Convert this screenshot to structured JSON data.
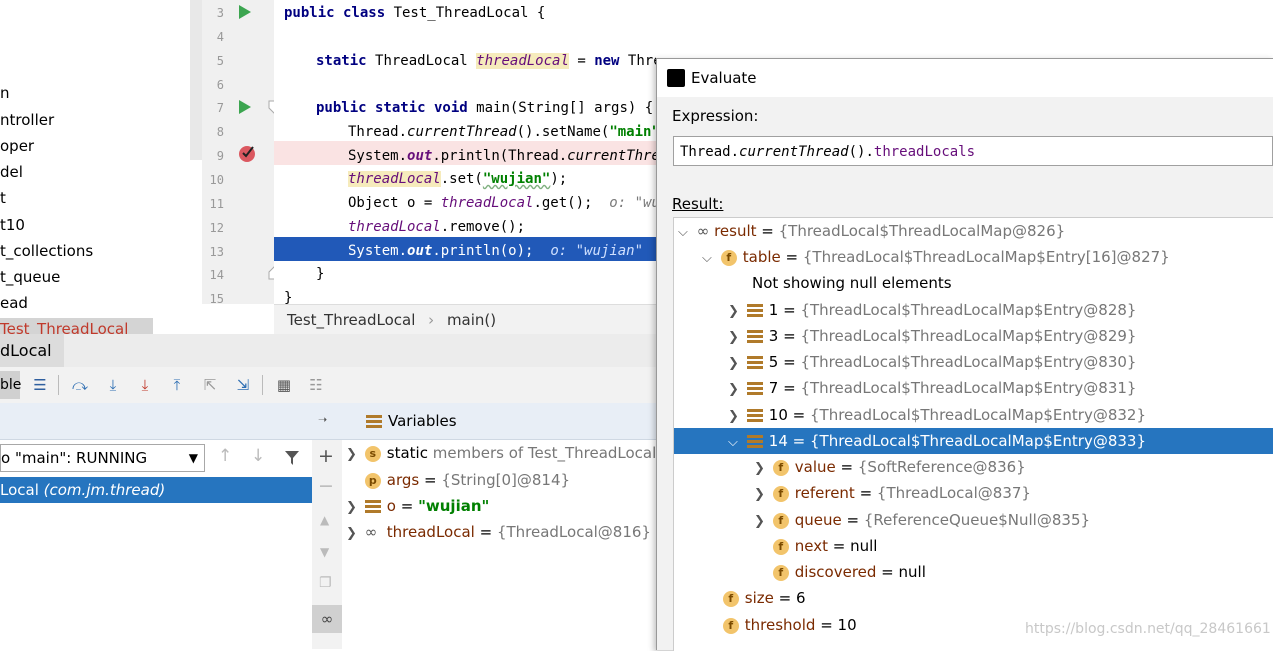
{
  "project_tree": {
    "items": [
      "n",
      "ntroller",
      "oper",
      "del",
      "t",
      "t10",
      "t_collections",
      "t_queue",
      "ead",
      "Test_ThreadLocal"
    ]
  },
  "editor": {
    "line_numbers": [
      "3",
      "4",
      "5",
      "6",
      "7",
      "8",
      "9",
      "10",
      "11",
      "12",
      "13",
      "14",
      "15"
    ],
    "lines": {
      "l3": {
        "kw1": "public class ",
        "rest": "Test_ThreadLocal {"
      },
      "l5": {
        "kw1": "static ",
        "type": "ThreadLocal ",
        "field": "threadLocal",
        "eq": " = ",
        "kw2": "new ",
        "rest": "Thre"
      },
      "l7": {
        "kw1": "public static void ",
        "rest": "main(String[] args) {"
      },
      "l8": {
        "a": "Thread.",
        "b": "currentThread",
        "c": "().setName(",
        "s": "\"main\"",
        "d": ")"
      },
      "l9": {
        "a": "System.",
        "b": "out",
        "c": ".println(Thread.",
        "d": "currentThrea"
      },
      "l10": {
        "field": "threadLocal",
        "a": ".set(",
        "s": "\"wujian\"",
        "b": ");"
      },
      "l11": {
        "a": "Object o = ",
        "field": "threadLocal",
        "b": ".get();",
        "hint": "  o: \"wuj"
      },
      "l12": {
        "field": "threadLocal",
        "a": ".remove();"
      },
      "l13": {
        "a": "System.",
        "b": "out",
        "c": ".println(o);",
        "hint": "  o: \"wujian\""
      },
      "l14": {
        "a": "}"
      },
      "l15": {
        "a": "}"
      }
    }
  },
  "breadcrumb": {
    "class": "Test_ThreadLocal",
    "sep": "›",
    "method": "main()"
  },
  "debug": {
    "tab_label": "dLocal",
    "toolbar_left_label": "ble",
    "frames_thread": "o \"main\": RUNNING",
    "frame_selected_a": "Local ",
    "frame_selected_b": "(com.jm.thread)",
    "variables_header": "Variables",
    "variables": [
      {
        "name": "static",
        "value": "members of Test_ThreadLocal",
        "badge": "s"
      },
      {
        "name": "args",
        "eq": " = ",
        "value": "{String[0]@814}",
        "badge": "p"
      },
      {
        "name": "o",
        "eq": " = ",
        "value": "\"wujian\""
      },
      {
        "name": "threadLocal",
        "eq": " = ",
        "value": "{ThreadLocal@816}"
      }
    ]
  },
  "evaluate": {
    "title": "Evaluate",
    "expression_label": "Expression:",
    "expression_a": "Thread.",
    "expression_b": "currentThread",
    "expression_c": "().",
    "expression_d": "threadLocals",
    "result_label": "Result:",
    "rows": {
      "result": {
        "name": "result",
        "eq": " = ",
        "value": "{ThreadLocal$ThreadLocalMap@826}"
      },
      "table": {
        "name": "table",
        "eq": " = ",
        "value": "{ThreadLocal$ThreadLocalMap$Entry[16]@827}"
      },
      "note": "Not showing null elements",
      "e1": {
        "name": "1",
        "eq": " = ",
        "value": "{ThreadLocal$ThreadLocalMap$Entry@828}"
      },
      "e3": {
        "name": "3",
        "eq": " = ",
        "value": "{ThreadLocal$ThreadLocalMap$Entry@829}"
      },
      "e5": {
        "name": "5",
        "eq": " = ",
        "value": "{ThreadLocal$ThreadLocalMap$Entry@830}"
      },
      "e7": {
        "name": "7",
        "eq": " = ",
        "value": "{ThreadLocal$ThreadLocalMap$Entry@831}"
      },
      "e10": {
        "name": "10",
        "eq": " = ",
        "value": "{ThreadLocal$ThreadLocalMap$Entry@832}"
      },
      "e14": {
        "name": "14",
        "eq": " = ",
        "value": "{ThreadLocal$ThreadLocalMap$Entry@833}"
      },
      "value": {
        "name": "value",
        "eq": " = ",
        "value": "{SoftReference@836}"
      },
      "referent": {
        "name": "referent",
        "eq": " = ",
        "value": "{ThreadLocal@837}"
      },
      "queue": {
        "name": "queue",
        "eq": " = ",
        "value": "{ReferenceQueue$Null@835}"
      },
      "next": {
        "name": "next",
        "eq": " = ",
        "value": "null"
      },
      "discovered": {
        "name": "discovered",
        "eq": " = ",
        "value": "null"
      },
      "size": {
        "name": "size",
        "eq": " = ",
        "value": "6"
      },
      "threshold": {
        "name": "threshold",
        "eq": " = ",
        "value": "10"
      }
    }
  },
  "watermark": "https://blog.csdn.net/qq_28461661"
}
